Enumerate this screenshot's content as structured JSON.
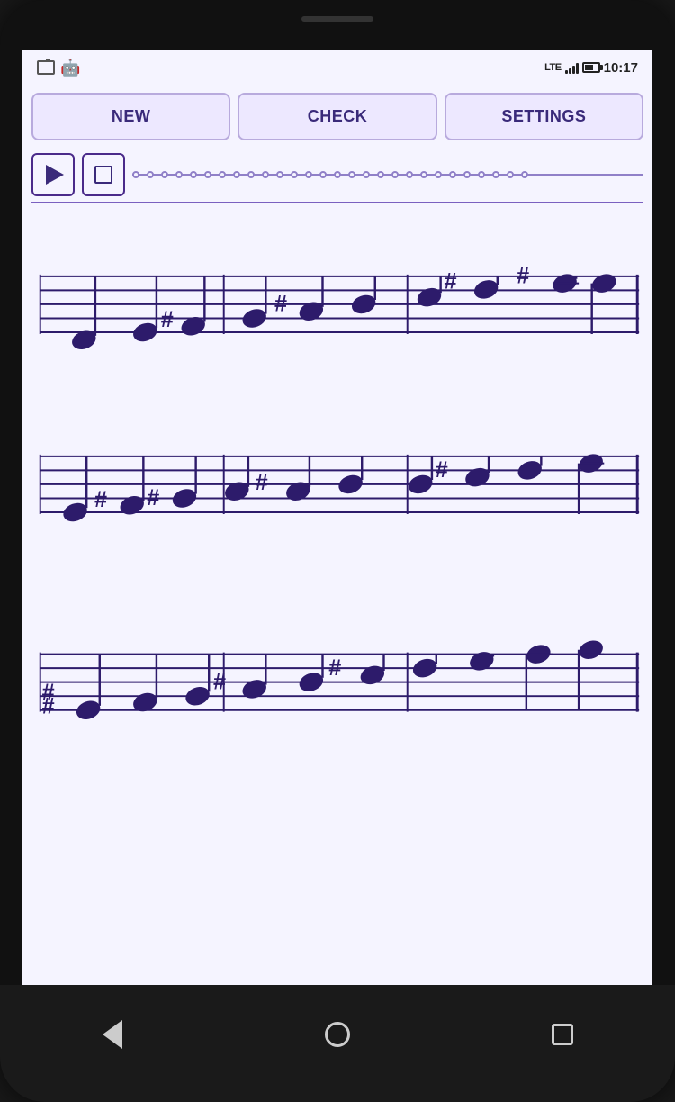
{
  "status": {
    "time": "10:17",
    "battery_level": 65
  },
  "toolbar": {
    "new_label": "NEW",
    "check_label": "CHECK",
    "settings_label": "SETTINGS"
  },
  "playback": {
    "play_label": "Play",
    "stop_label": "Stop",
    "progress_dots": 28
  },
  "nav": {
    "back_label": "Back",
    "home_label": "Home",
    "recents_label": "Recents"
  },
  "colors": {
    "accent": "#3a2a7a",
    "accent_light": "#ede8ff",
    "border": "#b8aadd",
    "staff": "#2d1b6b"
  }
}
